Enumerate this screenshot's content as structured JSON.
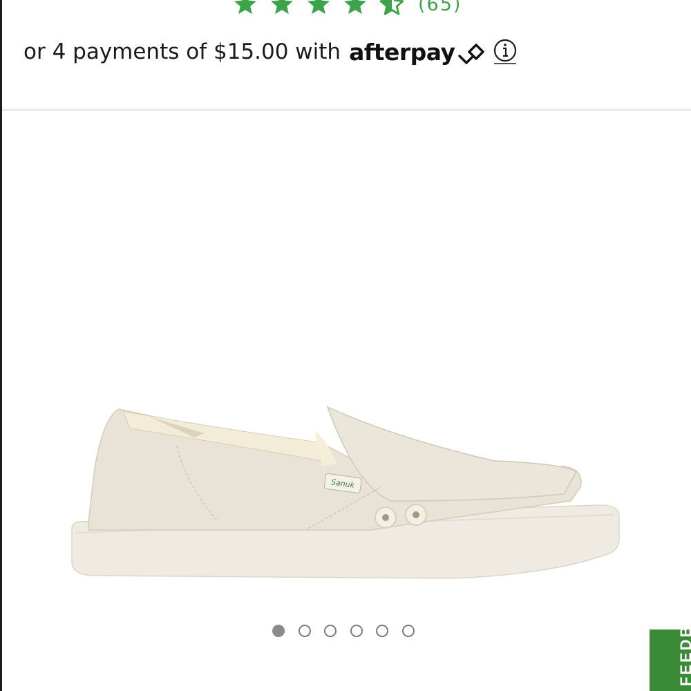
{
  "rating": {
    "stars_full": 4,
    "stars_half": 1,
    "review_count": "(65)",
    "star_color": "#3da34a"
  },
  "afterpay": {
    "text": "or 4 payments of $15.00 with",
    "brand": "afterpay",
    "logo_icon": "afterpay-arrows-icon",
    "info_icon": "info-circle-icon"
  },
  "product": {
    "image_icon": "slip-on-shoe-image",
    "brand_tag": "Sanuk"
  },
  "carousel": {
    "dots": [
      {
        "active": true
      },
      {
        "active": false
      },
      {
        "active": false
      },
      {
        "active": false
      },
      {
        "active": false
      },
      {
        "active": false
      }
    ]
  },
  "feedback": {
    "label": "FEEDBACK",
    "color": "#3a8a37"
  }
}
